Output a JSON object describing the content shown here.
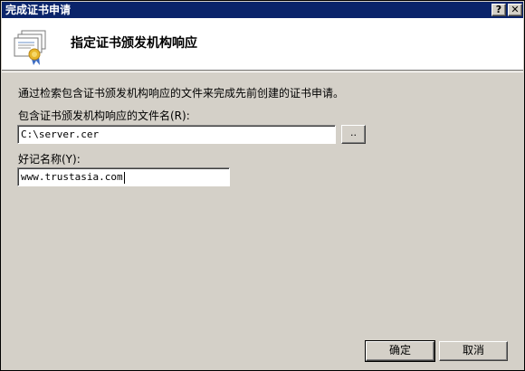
{
  "window": {
    "title": "完成证书申请",
    "help_label": "?",
    "close_label": "✕"
  },
  "header": {
    "title": "指定证书颁发机构响应",
    "icon": "certificate-icon"
  },
  "body": {
    "description": "通过检索包含证书颁发机构响应的文件来完成先前创建的证书申请。",
    "file_label": "包含证书颁发机构响应的文件名(R):",
    "file_value": "C:\\server.cer",
    "browse_label": "..",
    "name_label": "好记名称(Y):",
    "name_value": "www.trustasia.com"
  },
  "footer": {
    "ok_label": "确定",
    "cancel_label": "取消"
  },
  "colors": {
    "titlebar": "#0a246a",
    "face": "#d4d0c8",
    "header_bg": "#ffffff"
  }
}
